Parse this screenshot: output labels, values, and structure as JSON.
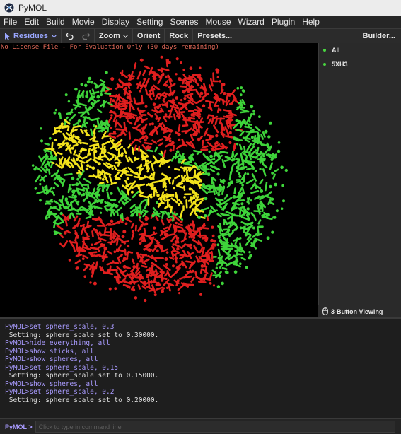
{
  "window": {
    "title": "PyMOL"
  },
  "menu": [
    "File",
    "Edit",
    "Build",
    "Movie",
    "Display",
    "Setting",
    "Scenes",
    "Mouse",
    "Wizard",
    "Plugin",
    "Help"
  ],
  "toolbar": {
    "selection_mode": "Residues",
    "zoom": "Zoom",
    "orient": "Orient",
    "rock": "Rock",
    "presets": "Presets...",
    "builder": "Builder..."
  },
  "viewport": {
    "license_text": "No License File - For Evaluation Only (30 days remaining)"
  },
  "objects": [
    {
      "name": "All",
      "enabled": true
    },
    {
      "name": "5XH3",
      "enabled": true
    }
  ],
  "mouse_mode": "3-Button Viewing",
  "console_lines": [
    {
      "type": "cmd",
      "text": "PyMOL>set sphere_scale, 0.3"
    },
    {
      "type": "out",
      "text": " Setting: sphere_scale set to 0.30000."
    },
    {
      "type": "cmd",
      "text": "PyMOL>hide everything, all"
    },
    {
      "type": "cmd",
      "text": "PyMOL>show sticks, all"
    },
    {
      "type": "cmd",
      "text": "PyMOL>show spheres, all"
    },
    {
      "type": "cmd",
      "text": "PyMOL>set sphere_scale, 0.15"
    },
    {
      "type": "out",
      "text": " Setting: sphere_scale set to 0.15000."
    },
    {
      "type": "cmd",
      "text": "PyMOL>show spheres, all"
    },
    {
      "type": "cmd",
      "text": "PyMOL>set sphere_scale, 0.2"
    },
    {
      "type": "out",
      "text": " Setting: sphere_scale set to 0.20000."
    }
  ],
  "command": {
    "prompt": "PyMOL >",
    "placeholder": "Click to type in command line"
  },
  "colors": {
    "green": "#3ed43a",
    "red": "#e01f1f",
    "yellow": "#f2e21c",
    "accent": "#a99bff"
  }
}
